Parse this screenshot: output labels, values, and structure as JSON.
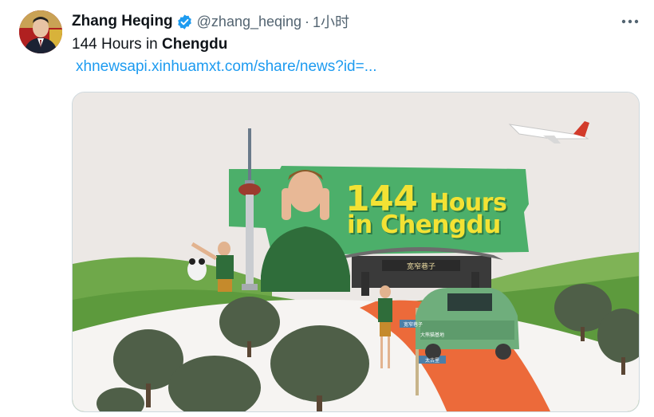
{
  "author": {
    "display_name": "Zhang Heqing",
    "handle": "@zhang_heqing",
    "separator": "·",
    "time": "1小时",
    "verified": true,
    "avatar_icon": "profile-photo"
  },
  "tweet": {
    "text_prefix": "144 Hours in ",
    "text_bold": "Chengdu",
    "link": "xhnewsapi.xinhuamxt.com/share/news?id=..."
  },
  "media": {
    "poster_title_number": "144",
    "poster_title_hours": "Hours",
    "poster_title_line2": "in Chengdu",
    "gate_sign": "宽窄巷子",
    "road_signs": [
      "宽窄巷子",
      "大熊猫基地",
      "太古里"
    ]
  },
  "icons": {
    "verified": "verified-badge-icon",
    "more": "more-options-icon"
  },
  "colors": {
    "link": "#1d9bf0",
    "verified": "#1d9bf0",
    "secondary_text": "#536471",
    "banner_green": "#4caf6a",
    "poster_title": "#f3e234",
    "road": "#ec6a3a"
  }
}
